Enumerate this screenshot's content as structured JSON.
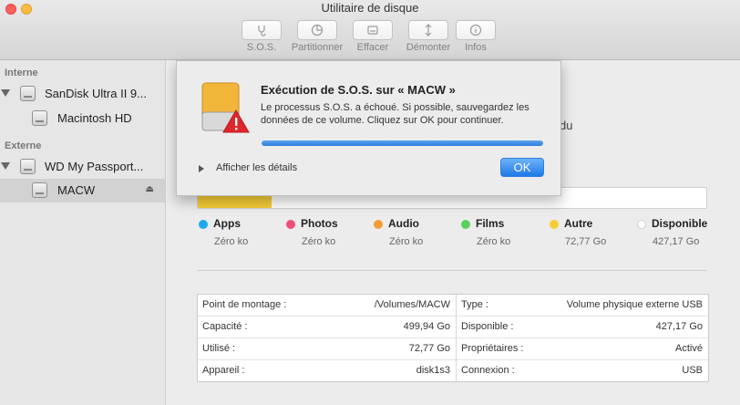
{
  "window": {
    "title": "Utilitaire de disque"
  },
  "toolbar": {
    "items": [
      {
        "label": "S.O.S.",
        "icon": "stethoscope-icon"
      },
      {
        "label": "Partitionner",
        "icon": "partition-icon"
      },
      {
        "label": "Effacer",
        "icon": "erase-icon"
      },
      {
        "label": "Démonter",
        "icon": "unmount-icon"
      },
      {
        "label": "Infos",
        "icon": "info-icon"
      }
    ]
  },
  "sidebar": {
    "section_internal": "Interne",
    "section_external": "Externe",
    "items": [
      {
        "label": "SanDisk Ultra II 9..."
      },
      {
        "label": "Macintosh HD"
      },
      {
        "label": "WD My Passport..."
      },
      {
        "label": "MACW"
      }
    ]
  },
  "main": {
    "partial_text": "du",
    "usage_bar": {
      "used_fraction": 0.146,
      "color": "#f6cd37"
    },
    "legend": [
      {
        "name": "Apps",
        "size": "Zéro ko",
        "color": "#1eaaf1"
      },
      {
        "name": "Photos",
        "size": "Zéro ko",
        "color": "#f04e77"
      },
      {
        "name": "Audio",
        "size": "Zéro ko",
        "color": "#f89b32"
      },
      {
        "name": "Films",
        "size": "Zéro ko",
        "color": "#5bd05a"
      },
      {
        "name": "Autre",
        "size": "72,77 Go",
        "color": "#f8cd32"
      },
      {
        "name": "Disponible",
        "size": "427,17 Go",
        "color": "#ffffff"
      }
    ],
    "info_left": [
      {
        "key": "Point de montage :",
        "value": "/Volumes/MACW"
      },
      {
        "key": "Capacité :",
        "value": "499,94 Go"
      },
      {
        "key": "Utilisé :",
        "value": "72,77 Go"
      },
      {
        "key": "Appareil :",
        "value": "disk1s3"
      }
    ],
    "info_right": [
      {
        "key": "Type :",
        "value": "Volume physique externe USB"
      },
      {
        "key": "Disponible :",
        "value": "427,17 Go"
      },
      {
        "key": "Propriétaires :",
        "value": "Activé"
      },
      {
        "key": "Connexion :",
        "value": "USB"
      }
    ]
  },
  "dialog": {
    "title": "Exécution de S.O.S. sur « MACW »",
    "message": "Le processus S.O.S. a échoué. Si possible, sauvegardez les données de ce volume. Cliquez sur OK pour continuer.",
    "progress_fraction": 1.0,
    "details_label": "Afficher les détails",
    "ok_label": "OK",
    "accent": "#2d7fdc",
    "alert_color": "#e0262b"
  }
}
